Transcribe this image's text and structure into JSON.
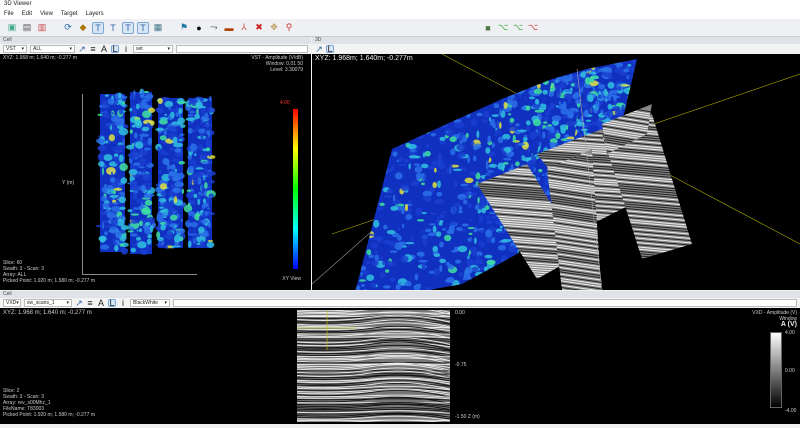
{
  "app": {
    "title": "3D Viewer",
    "menu": [
      "File",
      "Edit",
      "View",
      "Target",
      "Layers"
    ]
  },
  "toolbar_icons": [
    "open-icon",
    "import-icon",
    "export-icon",
    "refresh-icon",
    "navigate-icon",
    "tool-t1-icon",
    "tool-t2-icon",
    "tool-t3-icon",
    "tool-t4-icon",
    "image-icon",
    "target-icon",
    "sphere-icon",
    "link-icon",
    "layer-icon",
    "pick-icon",
    "delete-icon",
    "move-icon",
    "marker-icon",
    "cube-icon",
    "tree-icon",
    "branch-icon",
    "branch-delete-icon"
  ],
  "left_panel": {
    "title": "Cell",
    "mode": "VST",
    "array": "ALL",
    "colormap": "set",
    "readout": "XYZ: 1.968 m; 1.640 m; -0.277 m",
    "legend": [
      "VST - Amplitude (V/dB)",
      "Window: 0.01 50",
      "Level: 3.30079"
    ],
    "colorbar_top": "4.00",
    "axis_mid": "Y (m)",
    "view_label": "XY View",
    "status": [
      "Slice: 60",
      "Swath: 3 - Scan: 3",
      "Array: ALL",
      "Picked Point: 1.920 m; 1.580 m; -0.277 m"
    ]
  },
  "right_panel": {
    "title": "3D",
    "readout": "XYZ: 1.968m; 1.640m; -0.277m"
  },
  "bottom_panel": {
    "title": "Cell",
    "mode": "VXD",
    "array": "sw_scans_1",
    "colormap": "BlackWhite",
    "readout": "XYZ: 1.968 m; 1.640 m; -0.277 m",
    "z_ticks": [
      "0.00",
      "-0.75",
      "-1.50 Z (m)"
    ],
    "legend": "VXD - Amplitude (V)",
    "legend2": "Window",
    "unit": "A (V)",
    "colorbar_ticks": [
      "4.00",
      "0.00",
      "-4.00"
    ],
    "status": [
      "Slice: 2",
      "Swath: 3 - Scan: 3",
      "Array: rev_s00Mhz_1",
      "FileName: T83003",
      "Picked Point: 1.920 m; 1.580 m; -0.277 m"
    ]
  },
  "colors": {
    "accent": "#7aa7d8",
    "heat_base": "#1030c0"
  }
}
